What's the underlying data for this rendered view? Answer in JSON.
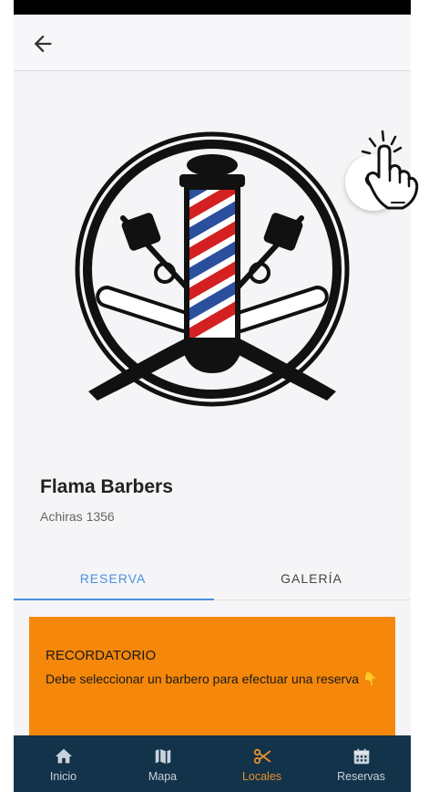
{
  "shop": {
    "name": "Flama Barbers",
    "address": "Achiras 1356"
  },
  "tabs": [
    {
      "label": "RESERVA",
      "active": true
    },
    {
      "label": "GALERÍA",
      "active": false
    }
  ],
  "reminder": {
    "title": "RECORDATORIO",
    "text": "Debe seleccionar un barbero para efectuar una reserva 👇"
  },
  "bottom_nav": [
    {
      "label": "Inicio",
      "icon": "home-icon",
      "active": false
    },
    {
      "label": "Mapa",
      "icon": "map-icon",
      "active": false
    },
    {
      "label": "Locales",
      "icon": "scissors-icon",
      "active": true
    },
    {
      "label": "Reservas",
      "icon": "calendar-icon",
      "active": false
    }
  ],
  "icons": {
    "back": "arrow-left-icon",
    "favorite": "heart-icon",
    "pointer": "pointing-hand-icon",
    "logo": "barber-pole-logo"
  },
  "colors": {
    "accent": "#4a90e2",
    "reminder_bg": "#f5870a",
    "nav_bg": "#13334a",
    "nav_active": "#e8912a"
  }
}
